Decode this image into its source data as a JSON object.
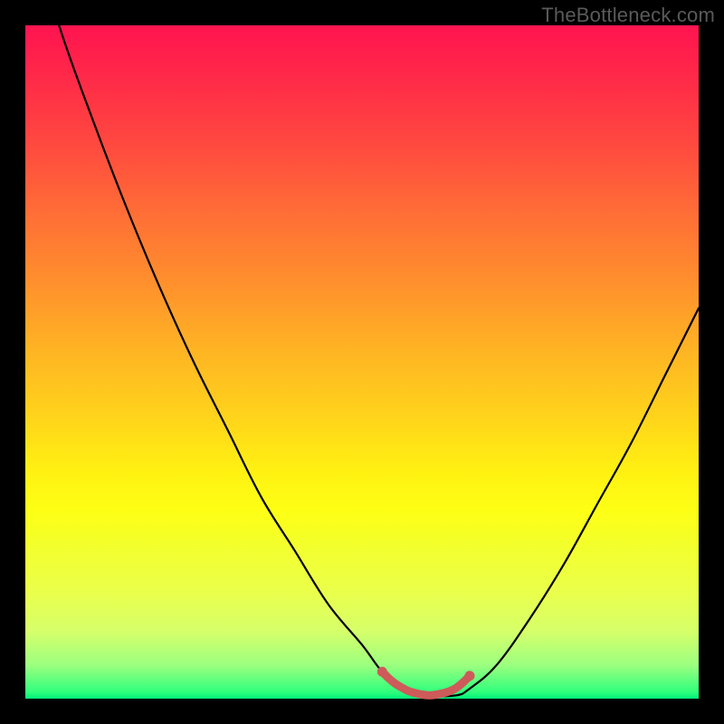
{
  "watermark": "TheBottleneck.com",
  "colors": {
    "background": "#000000",
    "curve": "#000000",
    "marker": "#ce5a5a",
    "gradient_top": "#ff1450",
    "gradient_bottom": "#00f07a"
  },
  "chart_data": {
    "type": "line",
    "title": "",
    "xlabel": "",
    "ylabel": "",
    "xlim": [
      0,
      100
    ],
    "ylim": [
      0,
      100
    ],
    "series": [
      {
        "name": "bottleneck-curve",
        "x": [
          0,
          5,
          10,
          15,
          20,
          25,
          30,
          35,
          40,
          45,
          50,
          53,
          56,
          60,
          64,
          66,
          70,
          75,
          80,
          85,
          90,
          95,
          100
        ],
        "y": [
          117,
          100,
          86,
          73,
          61,
          50,
          40,
          30,
          22,
          14,
          8,
          4,
          1.5,
          0.5,
          0.5,
          1.5,
          5,
          12,
          20,
          29,
          38,
          48,
          58
        ]
      },
      {
        "name": "optimal-range-marker",
        "x": [
          53,
          54,
          55,
          56,
          57,
          58,
          59,
          60,
          61,
          62,
          63,
          64,
          65,
          66
        ],
        "y": [
          4.0,
          3.0,
          2.2,
          1.6,
          1.1,
          0.8,
          0.6,
          0.5,
          0.6,
          0.8,
          1.1,
          1.6,
          2.4,
          3.4
        ]
      }
    ],
    "annotations": []
  }
}
